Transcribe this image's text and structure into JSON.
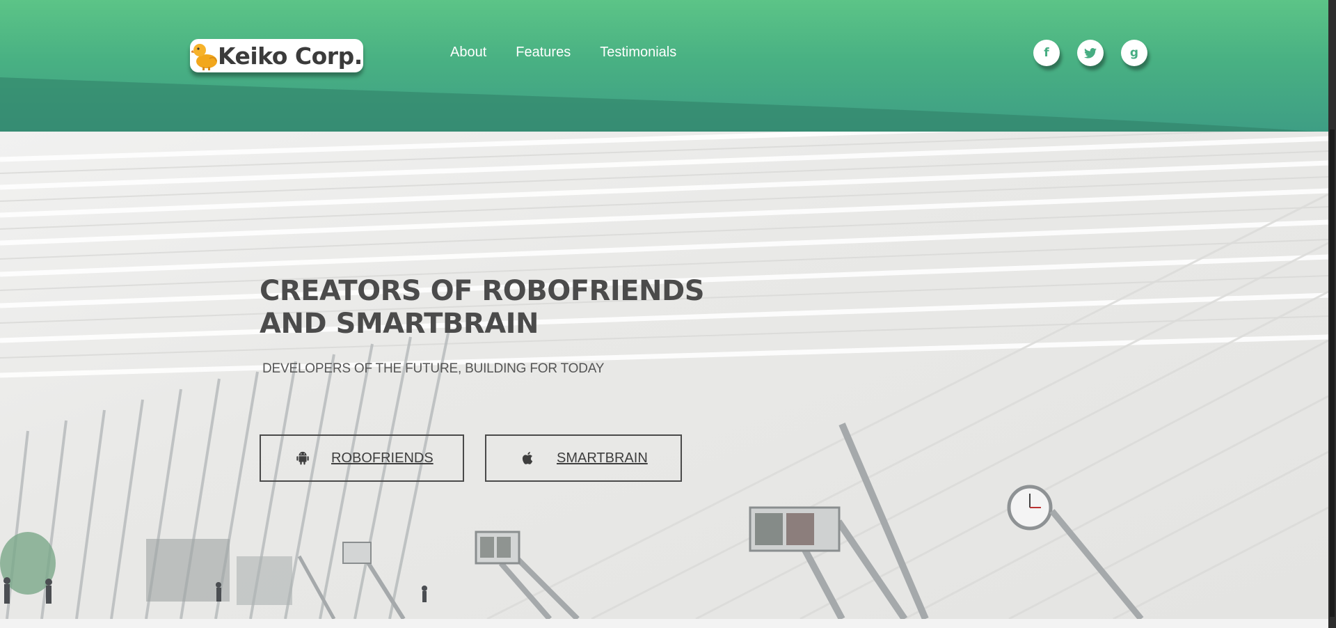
{
  "header": {
    "logo_text": "Keiko Corp.",
    "nav": [
      {
        "label": "About"
      },
      {
        "label": "Features"
      },
      {
        "label": "Testimonials"
      }
    ],
    "social": [
      {
        "icon": "facebook-icon",
        "glyph": "f"
      },
      {
        "icon": "twitter-icon",
        "glyph": "t"
      },
      {
        "icon": "google-icon",
        "glyph": "g"
      }
    ],
    "colors": {
      "gradient_top": "#5cc487",
      "gradient_bottom": "#3e9e84",
      "text": "#ffffff"
    }
  },
  "hero": {
    "title_line1": "CREATORS OF ROBOFRIENDS",
    "title_line2": "AND SMARTBRAIN",
    "subtitle": "DEVELOPERS OF THE FUTURE, BUILDING FOR TODAY",
    "buttons": [
      {
        "label": "ROBOFRIENDS",
        "icon": "android-icon"
      },
      {
        "label": "SMARTBRAIN",
        "icon": "apple-icon"
      }
    ]
  }
}
